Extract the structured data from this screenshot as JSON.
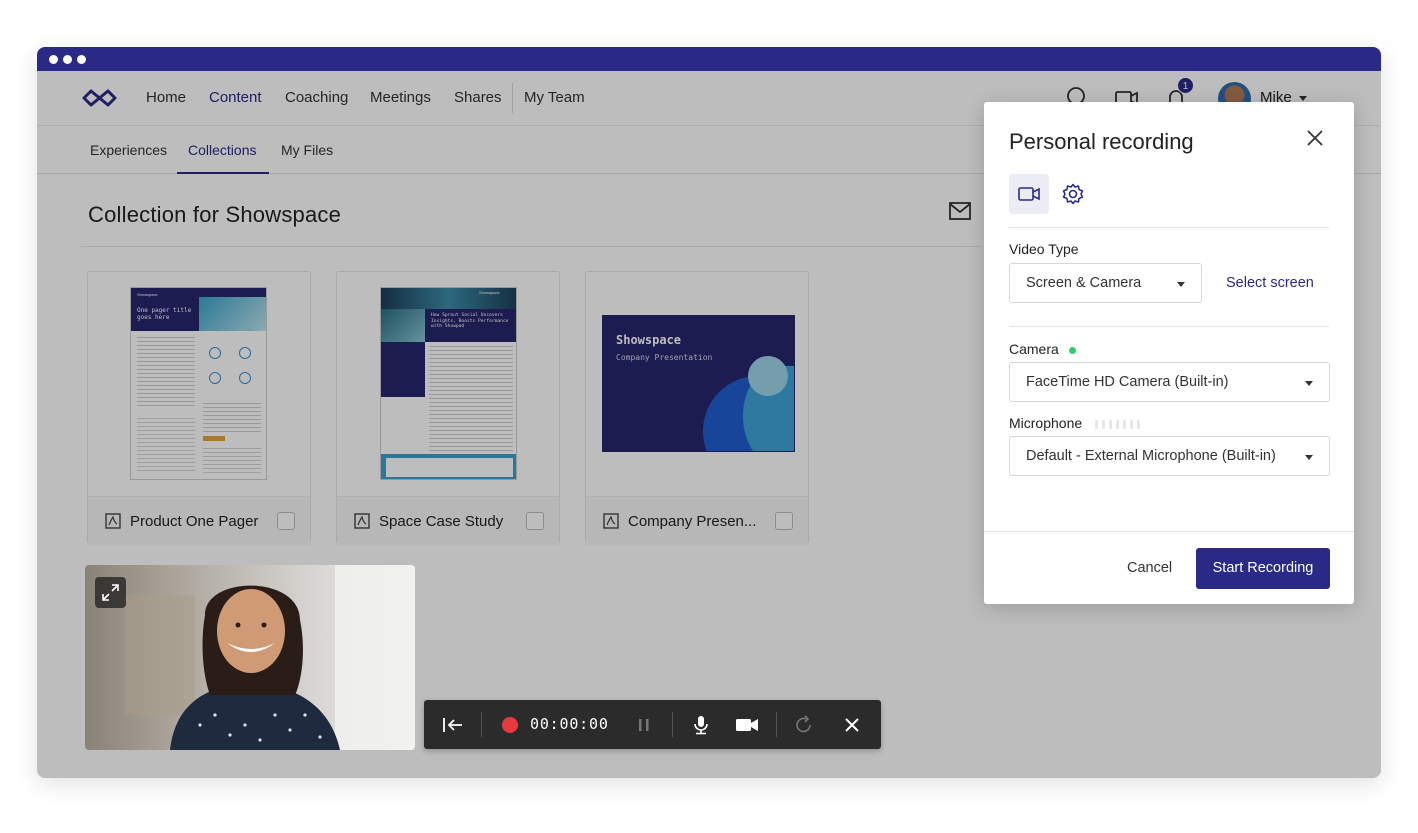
{
  "app": {
    "nav": [
      "Home",
      "Content",
      "Coaching",
      "Meetings",
      "Shares",
      "My Team"
    ],
    "active_nav": "Content",
    "notification_count": "1",
    "user_name": "Mike",
    "icons": [
      "logo-icon",
      "search-icon",
      "video-icon",
      "bell-icon",
      "avatar",
      "chevron-down-icon"
    ]
  },
  "subnav": {
    "items": [
      "Experiences",
      "Collections",
      "My Files"
    ],
    "active": "Collections"
  },
  "page": {
    "title": "Collection for Showspace",
    "cards": [
      {
        "name": "Product One Pager",
        "thumb_heading": "One pager title goes here",
        "thumb_brand": "Showspace"
      },
      {
        "name": "Space Case Study",
        "thumb_heading": "How Sprout Social Uncovers Insights, Boosts Performance with Showpad",
        "thumb_brand": "Showspace"
      },
      {
        "name": "Company Presen...",
        "thumb_heading": "Showspace",
        "thumb_subtitle": "Company Presentation"
      }
    ]
  },
  "recorder_toolbar": {
    "timer": "00:00:00",
    "icons": [
      "collapse-left-icon",
      "record-icon",
      "pause-icon",
      "microphone-icon",
      "camera-icon",
      "redo-icon",
      "close-icon"
    ]
  },
  "modal": {
    "title": "Personal recording",
    "tabs": [
      "video-icon",
      "settings-icon"
    ],
    "video_type_label": "Video Type",
    "video_type_value": "Screen & Camera",
    "select_screen": "Select screen",
    "camera_label": "Camera",
    "camera_value": "FaceTime HD Camera (Built-in)",
    "microphone_label": "Microphone",
    "microphone_value": "Default - External Microphone (Built-in)",
    "microphone_level": 0,
    "cancel": "Cancel",
    "start": "Start Recording"
  },
  "colors": {
    "brand": "#2a2a86",
    "camera_status": "#2ecc71",
    "record": "#e8393f"
  }
}
